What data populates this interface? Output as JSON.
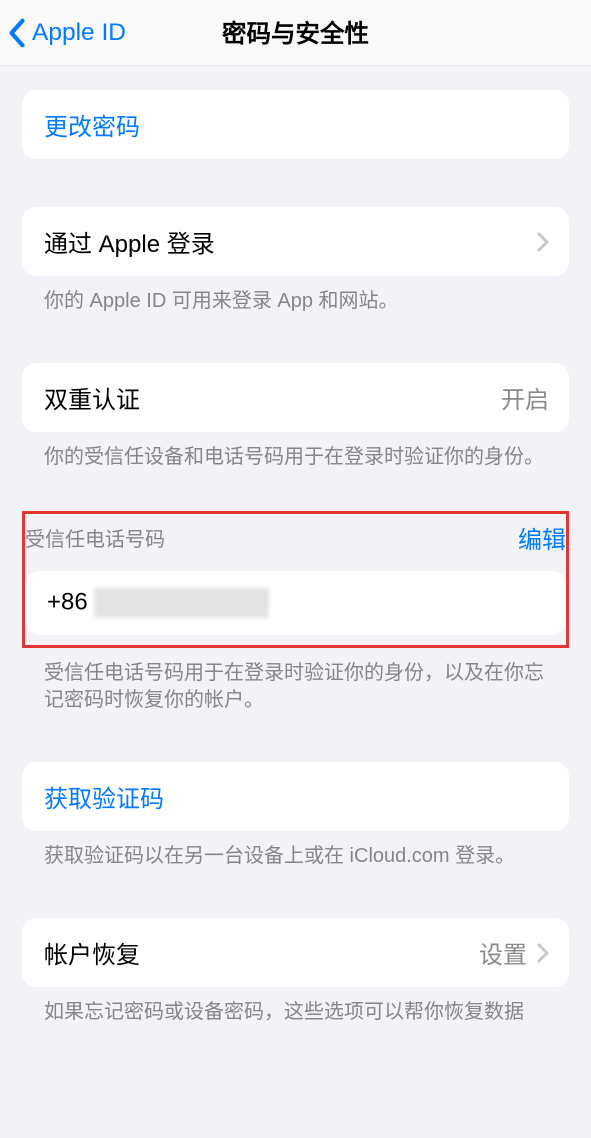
{
  "nav": {
    "back_label": "Apple ID",
    "title": "密码与安全性"
  },
  "change_password": {
    "label": "更改密码"
  },
  "sign_in_with_apple": {
    "label": "通过 Apple 登录",
    "footer": "你的 Apple ID 可用来登录 App 和网站。"
  },
  "two_factor": {
    "label": "双重认证",
    "value": "开启",
    "footer": "你的受信任设备和电话号码用于在登录时验证你的身份。"
  },
  "trusted_phone": {
    "header": "受信任电话号码",
    "edit_label": "编辑",
    "number_prefix": "+86",
    "footer": "受信任电话号码用于在登录时验证你的身份，以及在你忘记密码时恢复你的帐户。"
  },
  "get_code": {
    "label": "获取验证码",
    "footer": "获取验证码以在另一台设备上或在 iCloud.com 登录。"
  },
  "account_recovery": {
    "label": "帐户恢复",
    "value": "设置",
    "footer": "如果忘记密码或设备密码，这些选项可以帮你恢复数据"
  }
}
